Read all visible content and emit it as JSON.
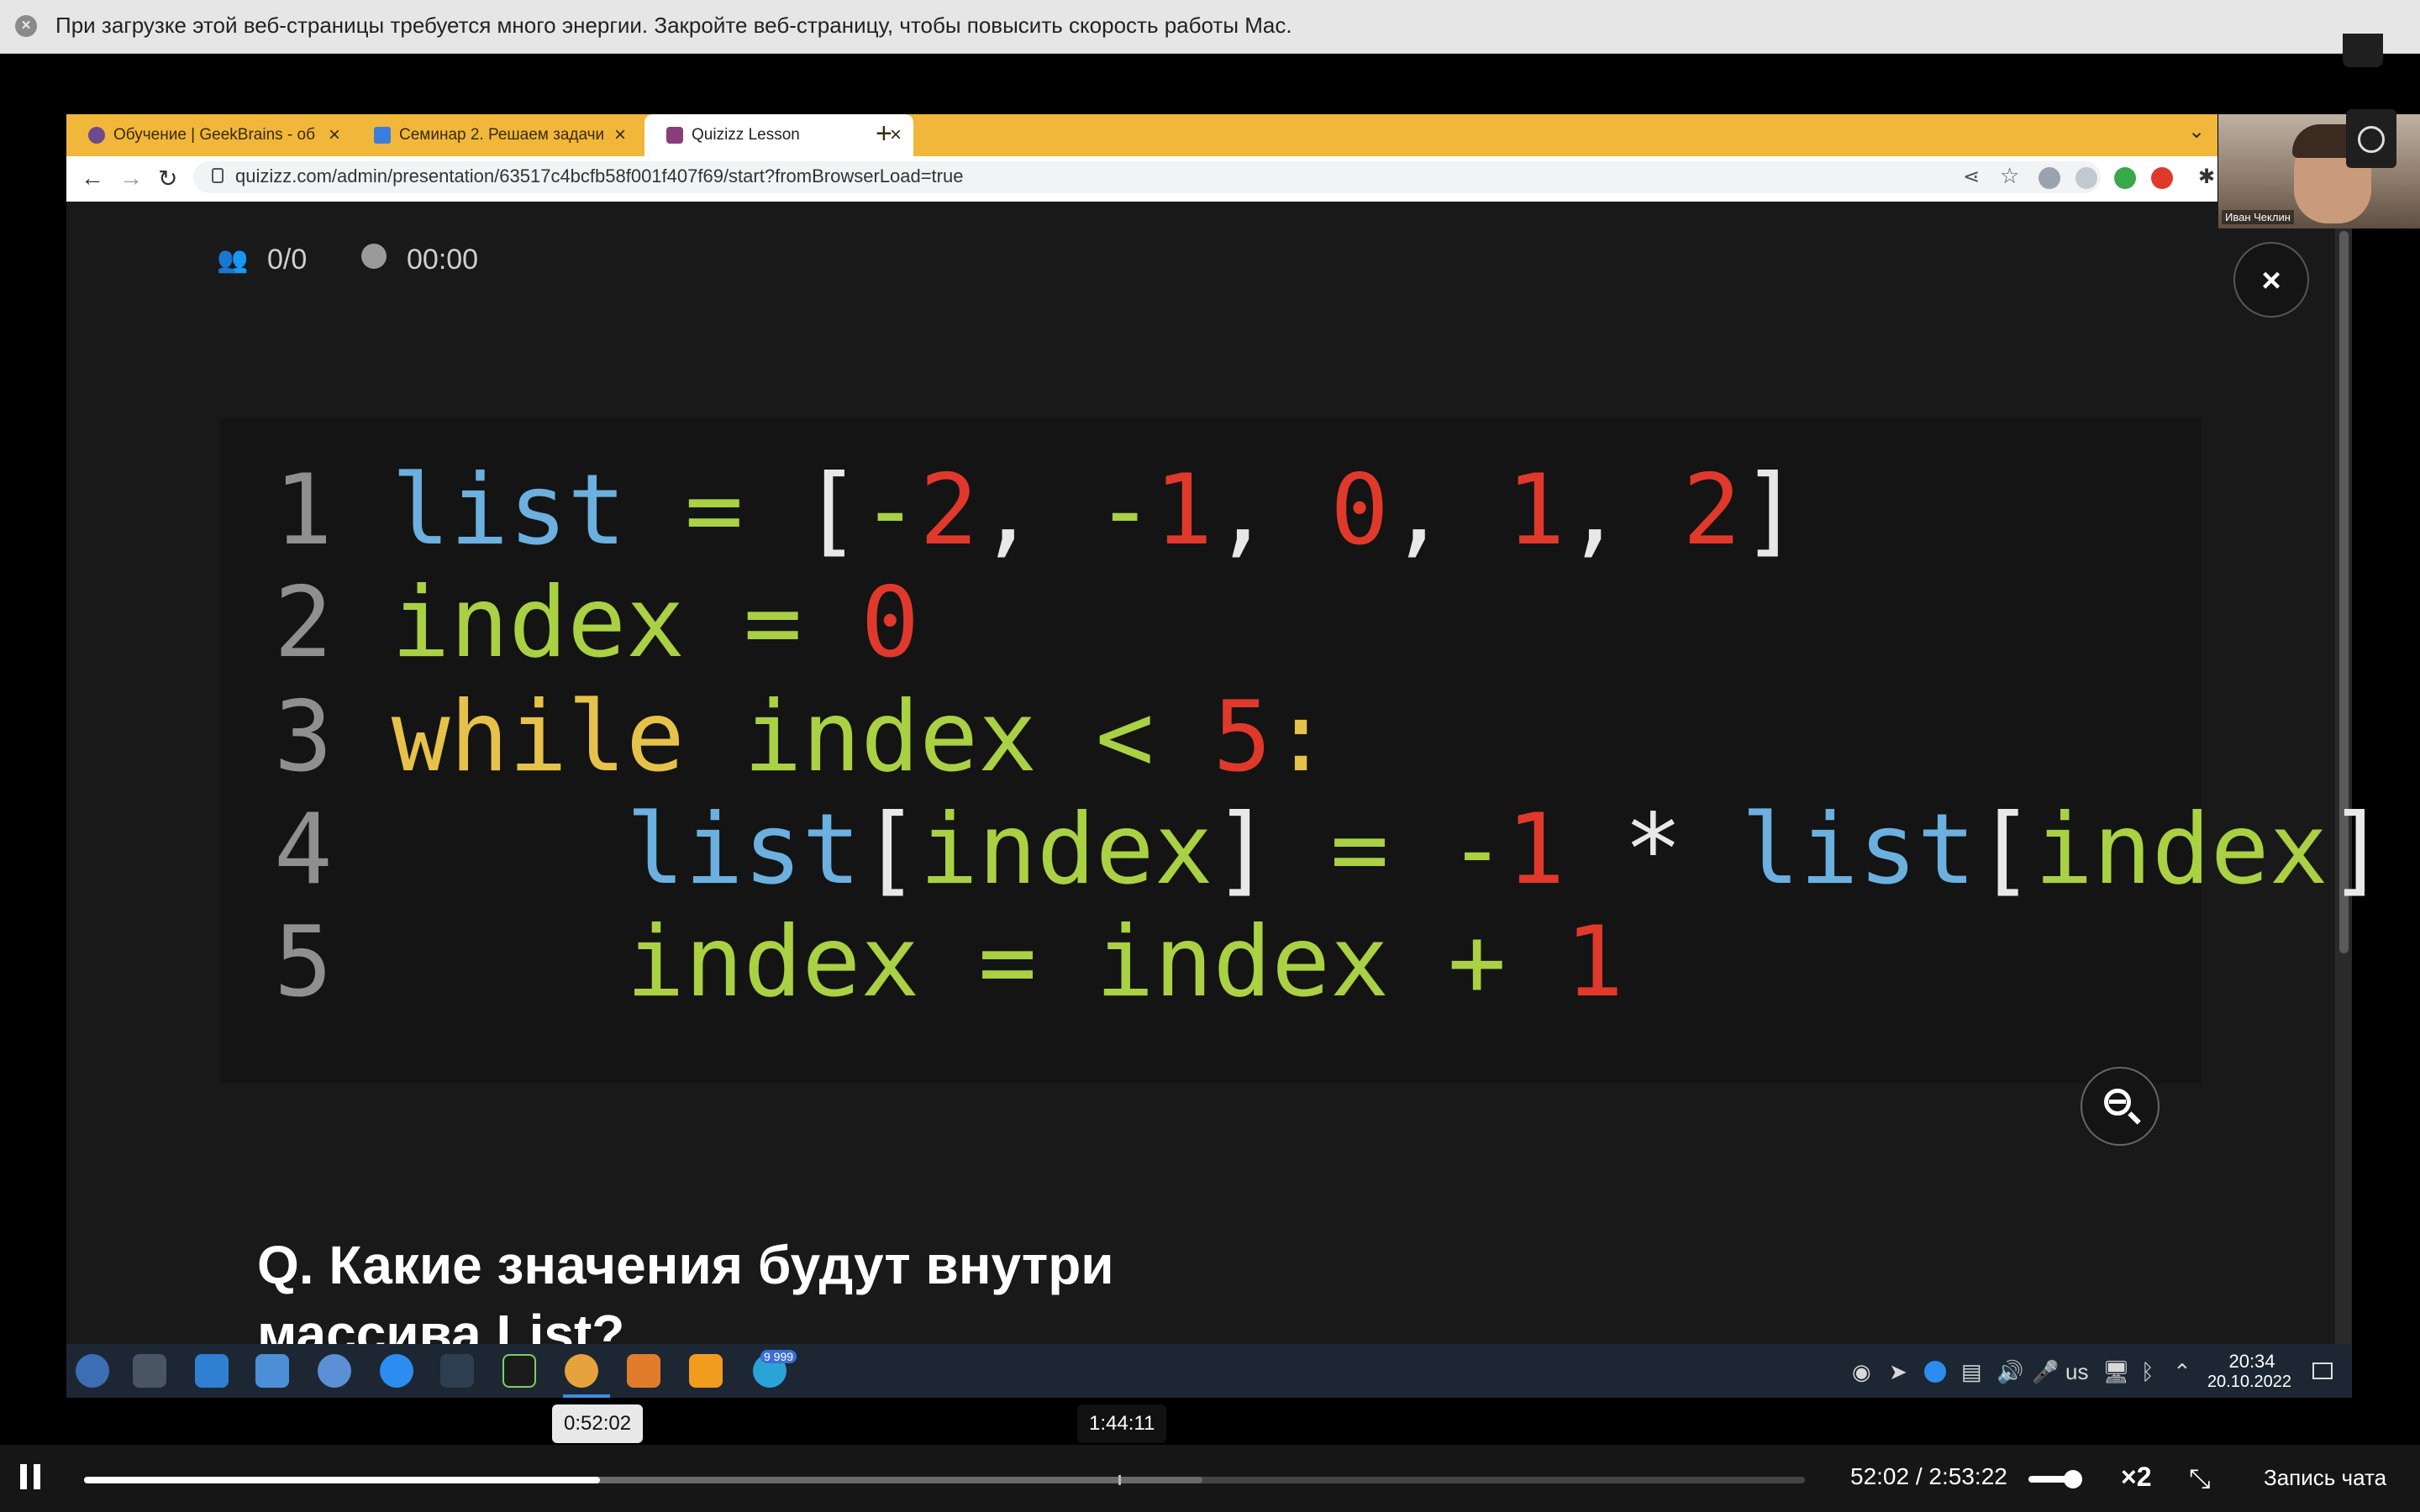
{
  "system_notice": {
    "text": "При загрузке этой веб-страницы требуется много энергии. Закройте веб-страницу, чтобы повысить скорость работы Mac.",
    "close_icon": "close-circle-icon"
  },
  "browser": {
    "tabs": [
      {
        "label": "Обучение | GeekBrains - об",
        "icon": "geekbrains-icon",
        "active": false
      },
      {
        "label": "Семинар 2. Решаем задачи",
        "icon": "slides-icon",
        "active": false
      },
      {
        "label": "Quizizz Lesson",
        "icon": "quizizz-icon",
        "active": true
      }
    ],
    "new_tab": "+",
    "url": "quizizz.com/admin/presentation/63517c4bcfb58f001f407f69/start?fromBrowserLoad=true",
    "nav": {
      "back": "←",
      "forward": "→",
      "reload": "↻"
    }
  },
  "quiz": {
    "players": "0/0",
    "timer": "00:00",
    "close": "×",
    "code_lines": [
      {
        "num": "1",
        "tokens": [
          {
            "t": " ",
            "c": "wh"
          },
          {
            "t": "list",
            "c": "id"
          },
          {
            "t": " = ",
            "c": "gr"
          },
          {
            "t": "[",
            "c": "wh"
          },
          {
            "t": "-",
            "c": "gr"
          },
          {
            "t": "2",
            "c": "nm"
          },
          {
            "t": ", ",
            "c": "wh"
          },
          {
            "t": "-",
            "c": "gr"
          },
          {
            "t": "1",
            "c": "nm"
          },
          {
            "t": ", ",
            "c": "wh"
          },
          {
            "t": "0",
            "c": "nm"
          },
          {
            "t": ", ",
            "c": "wh"
          },
          {
            "t": "1",
            "c": "nm"
          },
          {
            "t": ", ",
            "c": "wh"
          },
          {
            "t": "2",
            "c": "nm"
          },
          {
            "t": "]",
            "c": "wh"
          }
        ]
      },
      {
        "num": "2",
        "tokens": [
          {
            "t": " ",
            "c": "wh"
          },
          {
            "t": "index",
            "c": "gr"
          },
          {
            "t": " = ",
            "c": "gr"
          },
          {
            "t": "0",
            "c": "nm"
          }
        ]
      },
      {
        "num": "3",
        "tokens": [
          {
            "t": " ",
            "c": "wh"
          },
          {
            "t": "while",
            "c": "kw"
          },
          {
            "t": " ",
            "c": "wh"
          },
          {
            "t": "index",
            "c": "gr"
          },
          {
            "t": " < ",
            "c": "gr"
          },
          {
            "t": "5",
            "c": "nm"
          },
          {
            "t": ":",
            "c": "kw"
          }
        ]
      },
      {
        "num": "4",
        "tokens": [
          {
            "t": "     ",
            "c": "wh"
          },
          {
            "t": "list",
            "c": "id"
          },
          {
            "t": "[",
            "c": "wh"
          },
          {
            "t": "index",
            "c": "gr"
          },
          {
            "t": "]",
            "c": "wh"
          },
          {
            "t": " = ",
            "c": "gr"
          },
          {
            "t": "-",
            "c": "gr"
          },
          {
            "t": "1",
            "c": "nm"
          },
          {
            "t": " * ",
            "c": "wh"
          },
          {
            "t": "list",
            "c": "id"
          },
          {
            "t": "[",
            "c": "wh"
          },
          {
            "t": "index",
            "c": "gr"
          },
          {
            "t": "]",
            "c": "wh"
          }
        ]
      },
      {
        "num": "5",
        "tokens": [
          {
            "t": "     ",
            "c": "wh"
          },
          {
            "t": "index",
            "c": "gr"
          },
          {
            "t": " = ",
            "c": "gr"
          },
          {
            "t": "index",
            "c": "gr"
          },
          {
            "t": " + ",
            "c": "gr"
          },
          {
            "t": "1",
            "c": "nm"
          }
        ]
      }
    ],
    "question_line1": "Q.  Какие значения будут внутри",
    "question_line2": "массива List?"
  },
  "video_tile": {
    "name": "Иван Чеклин"
  },
  "taskbar": {
    "apps": [
      "fedora-icon",
      "settings-icon",
      "store-icon",
      "files-icon",
      "chrome-icon",
      "zoom-icon",
      "vscode-icon",
      "pycharm-icon",
      "chrome-icon",
      "document-icon",
      "git-icon",
      "telegram-icon"
    ],
    "badge": "9 999",
    "tray": {
      "layout": "us",
      "time": "20:34",
      "date": "20.10.2022"
    }
  },
  "player": {
    "hover_time": "0:52:02",
    "marker_time": "1:44:11",
    "current": "52:02",
    "separator": "/",
    "duration": "2:53:22",
    "played_fraction": 0.3,
    "buffered_fraction": 0.65,
    "volume_fraction": 1.0,
    "speed": "×2",
    "chat_record": "Запись чата"
  },
  "colors": {
    "code_keyword": "#e6c24a",
    "code_identifier": "#6bb0de",
    "code_green": "#a9d143",
    "code_number": "#e0392b",
    "browser_tabbar": "#f0b73a"
  }
}
